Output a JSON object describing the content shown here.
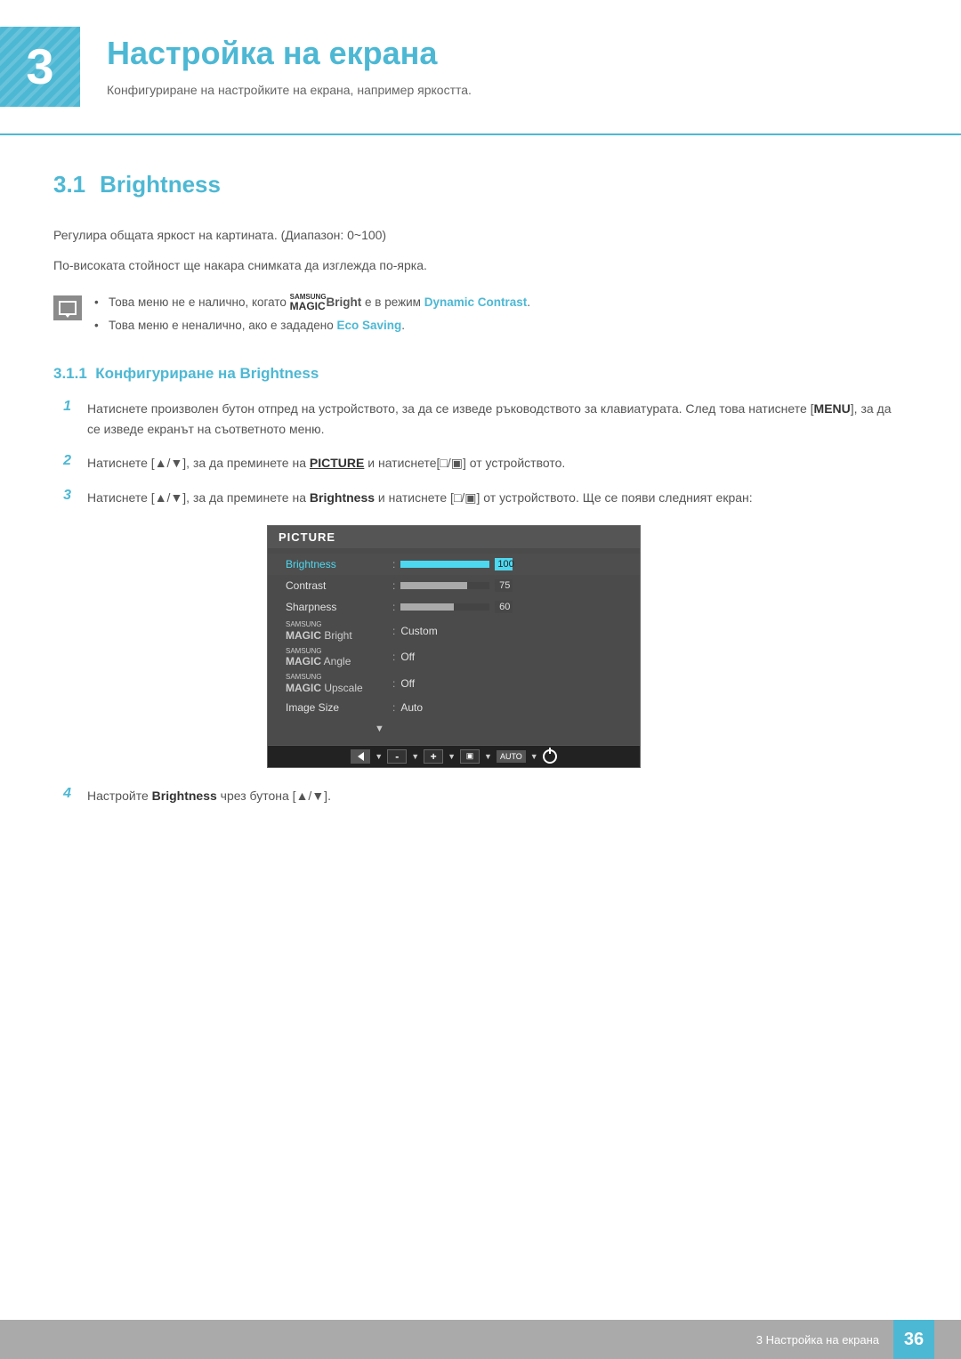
{
  "chapter": {
    "number": "3",
    "title": "Настройка на екрана",
    "subtitle": "Конфигуриране на настройките на екрана, например яркостта."
  },
  "section31": {
    "number": "3.1",
    "title": "Brightness",
    "desc1": "Регулира общата яркост на картината. (Диапазон: 0~100)",
    "desc2": "По-високата стойност ще накара снимката да изглежда по-ярка.",
    "note1": "Това меню не е налично, когато SAMSUNGMAGICBright е в режим Dynamic Contrast.",
    "note2": "Това меню е неналично, ако е зададено Eco Saving."
  },
  "subsection311": {
    "number": "3.1.1",
    "title": "Конфигуриране на Brightness"
  },
  "steps": {
    "step1": "Натиснете произволен бутон отпред на устройството, за да се изведе ръководството за клавиатурата. След това натиснете [MENU], за да се изведе екранът на съответното меню.",
    "step2": "Натиснете [▲/▼], за да преминете на PICTURE и натиснете[□/▣] от устройството.",
    "step3": "Натиснете [▲/▼], за да преминете на Brightness и натиснете [□/▣] от устройството. Ще се появи следният екран:",
    "step4": "Настройте Brightness чрез бутона [▲/▼]."
  },
  "monitor_menu": {
    "title": "PICTURE",
    "items": [
      {
        "name": "Brightness",
        "type": "bar",
        "value": 100,
        "max": 100,
        "highlighted": true
      },
      {
        "name": "Contrast",
        "type": "bar",
        "value": 75,
        "max": 100,
        "highlighted": false
      },
      {
        "name": "Sharpness",
        "type": "bar",
        "value": 60,
        "max": 100,
        "highlighted": false
      },
      {
        "name": "SAMSUNG MAGIC Bright",
        "type": "text",
        "value": "Custom",
        "highlighted": false
      },
      {
        "name": "SAMSUNG MAGIC Angle",
        "type": "text",
        "value": "Off",
        "highlighted": false
      },
      {
        "name": "SAMSUNG MAGIC Upscale",
        "type": "text",
        "value": "Off",
        "highlighted": false
      },
      {
        "name": "Image Size",
        "type": "text",
        "value": "Auto",
        "highlighted": false
      }
    ]
  },
  "footer": {
    "text": "3 Настройка на екрана",
    "page": "36"
  }
}
